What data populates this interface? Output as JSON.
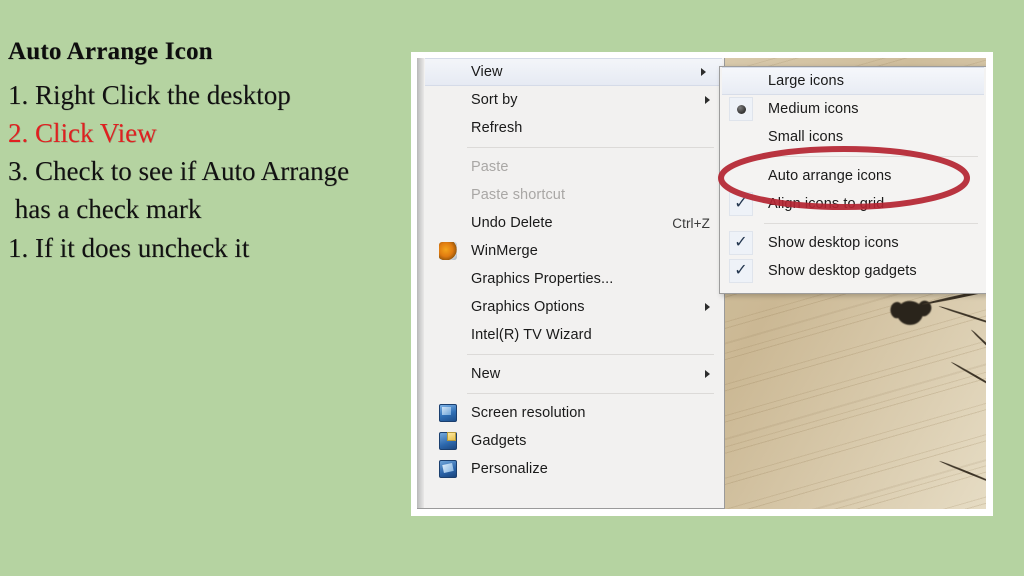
{
  "slide": {
    "background_color": "#b5d3a1",
    "title": "Auto Arrange Icon",
    "steps": [
      {
        "text": "1. Right Click the desktop",
        "color": "#111111"
      },
      {
        "text": "2. Click View",
        "color": "#e02020"
      },
      {
        "text": "3. Check to see if Auto Arrange",
        "color": "#111111"
      },
      {
        "text": " has a check mark",
        "color": "#111111"
      },
      {
        "text": "1. If it does uncheck it",
        "color": "#111111"
      }
    ]
  },
  "screenshot": {
    "desktop": {
      "wallpaper_description": "sepia sheet music with dark flower silhouette",
      "flower_icon": "flower-silhouette"
    },
    "context_menu": {
      "items": [
        {
          "label": "View",
          "icon": null,
          "shortcut": "",
          "submenu": true,
          "disabled": false,
          "highlight": true
        },
        {
          "label": "Sort by",
          "icon": null,
          "shortcut": "",
          "submenu": true,
          "disabled": false,
          "highlight": false
        },
        {
          "label": "Refresh",
          "icon": null,
          "shortcut": "",
          "submenu": false,
          "disabled": false,
          "highlight": false
        },
        {
          "separator": true
        },
        {
          "label": "Paste",
          "icon": null,
          "shortcut": "",
          "submenu": false,
          "disabled": true,
          "highlight": false
        },
        {
          "label": "Paste shortcut",
          "icon": null,
          "shortcut": "",
          "submenu": false,
          "disabled": true,
          "highlight": false
        },
        {
          "label": "Undo Delete",
          "icon": null,
          "shortcut": "Ctrl+Z",
          "submenu": false,
          "disabled": false,
          "highlight": false
        },
        {
          "label": "WinMerge",
          "icon": "winmerge-icon",
          "shortcut": "",
          "submenu": false,
          "disabled": false,
          "highlight": false
        },
        {
          "label": "Graphics Properties...",
          "icon": null,
          "shortcut": "",
          "submenu": false,
          "disabled": false,
          "highlight": false
        },
        {
          "label": "Graphics Options",
          "icon": null,
          "shortcut": "",
          "submenu": true,
          "disabled": false,
          "highlight": false
        },
        {
          "label": "Intel(R) TV Wizard",
          "icon": null,
          "shortcut": "",
          "submenu": false,
          "disabled": false,
          "highlight": false
        },
        {
          "separator": true
        },
        {
          "label": "New",
          "icon": null,
          "shortcut": "",
          "submenu": true,
          "disabled": false,
          "highlight": false
        },
        {
          "separator": true
        },
        {
          "label": "Screen resolution",
          "icon": "screen-resolution-icon",
          "shortcut": "",
          "submenu": false,
          "disabled": false,
          "highlight": false
        },
        {
          "label": "Gadgets",
          "icon": "gadgets-icon",
          "shortcut": "",
          "submenu": false,
          "disabled": false,
          "highlight": false
        },
        {
          "label": "Personalize",
          "icon": "personalize-icon",
          "shortcut": "",
          "submenu": false,
          "disabled": false,
          "highlight": false
        }
      ]
    },
    "view_submenu": {
      "items": [
        {
          "label": "Large icons",
          "mark": "none",
          "highlight": true
        },
        {
          "label": "Medium icons",
          "mark": "radio",
          "highlight": false
        },
        {
          "label": "Small icons",
          "mark": "none",
          "highlight": false
        },
        {
          "separator": true
        },
        {
          "label": "Auto arrange icons",
          "mark": "none",
          "highlight": false
        },
        {
          "label": "Align icons to grid",
          "mark": "check",
          "highlight": false
        },
        {
          "separator": true
        },
        {
          "label": "Show desktop icons",
          "mark": "check",
          "highlight": false
        },
        {
          "label": "Show desktop gadgets",
          "mark": "check",
          "highlight": false
        }
      ],
      "check_glyph": "✓"
    },
    "annotation": {
      "shape": "ellipse",
      "color": "#b32431",
      "targets": "Auto arrange icons"
    }
  }
}
